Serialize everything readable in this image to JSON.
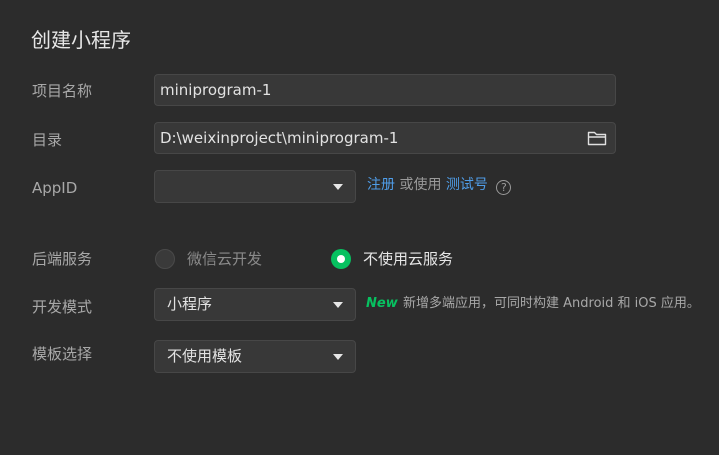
{
  "dialog": {
    "title": "创建小程序"
  },
  "project_name": {
    "label": "项目名称",
    "value": "miniprogram-1"
  },
  "directory": {
    "label": "目录",
    "value": "D:\\weixinproject\\miniprogram-1",
    "icon": "folder-icon"
  },
  "appid": {
    "label": "AppID",
    "value": "",
    "register_link": "注册",
    "or_use": "或使用",
    "test_id_link": "测试号",
    "help_glyph": "?"
  },
  "backend": {
    "label": "后端服务",
    "options": [
      {
        "label": "微信云开发",
        "selected": false
      },
      {
        "label": "不使用云服务",
        "selected": true
      }
    ]
  },
  "dev_mode": {
    "label": "开发模式",
    "value": "小程序",
    "new_tag": "New",
    "new_desc": "新增多端应用，可同时构建 Android 和 iOS 应用。"
  },
  "template": {
    "label": "模板选择",
    "value": "不使用模板"
  },
  "colors": {
    "background": "#2c2c2c",
    "field_bg": "#383838",
    "accent_green": "#07c160",
    "link_blue": "#4f9de8"
  }
}
